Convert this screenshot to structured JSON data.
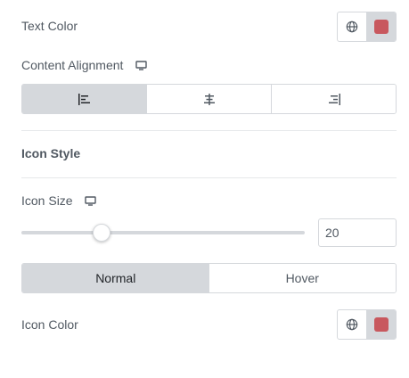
{
  "text_color": {
    "label": "Text Color",
    "swatch_color": "#c8585e"
  },
  "content_alignment": {
    "label": "Content Alignment",
    "device_icon": "desktop-icon",
    "options": [
      {
        "name": "align-left-icon",
        "active": true
      },
      {
        "name": "align-center-icon",
        "active": false
      },
      {
        "name": "align-right-icon",
        "active": false
      }
    ]
  },
  "icon_style": {
    "title": "Icon Style"
  },
  "icon_size": {
    "label": "Icon Size",
    "device_icon": "desktop-icon",
    "value": "20",
    "slider_fraction": 0.27
  },
  "state_tabs": {
    "normal": "Normal",
    "hover": "Hover",
    "active": "normal"
  },
  "icon_color": {
    "label": "Icon Color",
    "swatch_color": "#c8585e"
  },
  "colors": {
    "text": "#515962",
    "border": "#d5d8dc",
    "active_bg": "#d5d8dc"
  }
}
